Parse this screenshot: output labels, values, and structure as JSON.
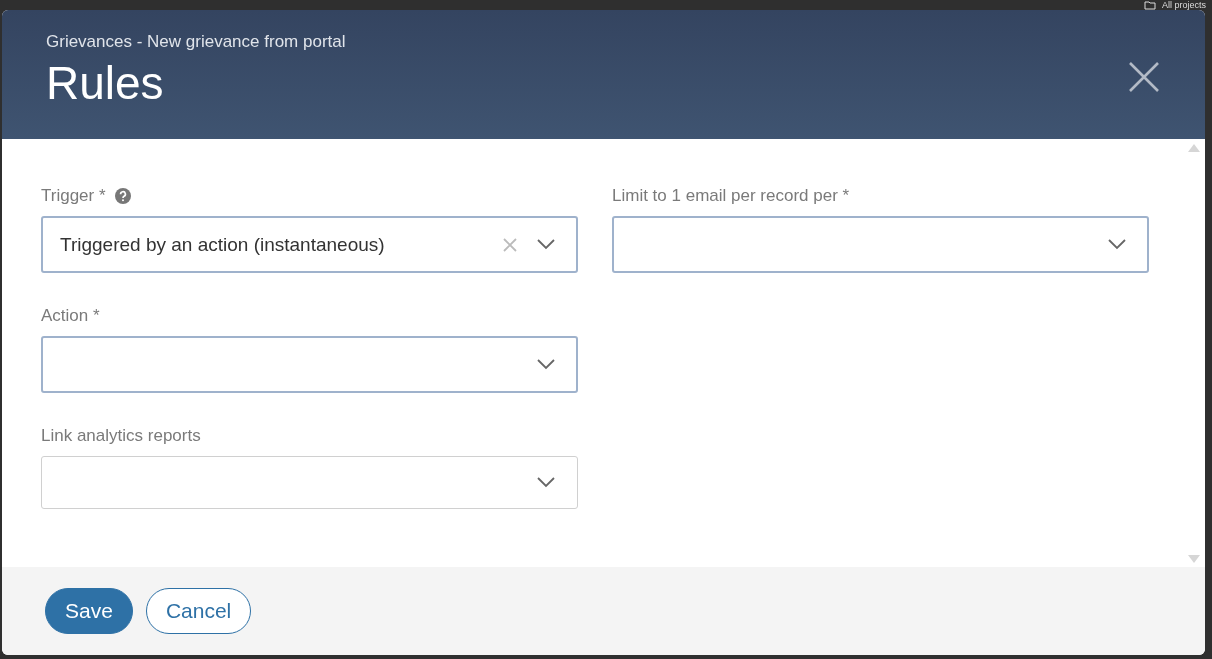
{
  "background": {
    "link": "All projects"
  },
  "dialog": {
    "breadcrumb": "Grievances - New grievance from portal",
    "title": "Rules"
  },
  "left_column": [
    {
      "label": "Trigger *",
      "help": true,
      "value": "Triggered by an action (instantaneous)",
      "clearable": true,
      "highlighted": true
    },
    {
      "label": "Action *",
      "help": false,
      "clearable": false,
      "highlighted": true
    },
    {
      "label": "Link analytics reports",
      "help": false,
      "clearable": false,
      "highlighted": false
    }
  ],
  "right_column": [
    {
      "label": "Limit to 1 email per record per *",
      "help": false,
      "clearable": false,
      "highlighted": true
    }
  ],
  "buttons": [
    {
      "label": "Save",
      "kind": "primary"
    },
    {
      "label": "Cancel",
      "kind": "secondary"
    }
  ]
}
